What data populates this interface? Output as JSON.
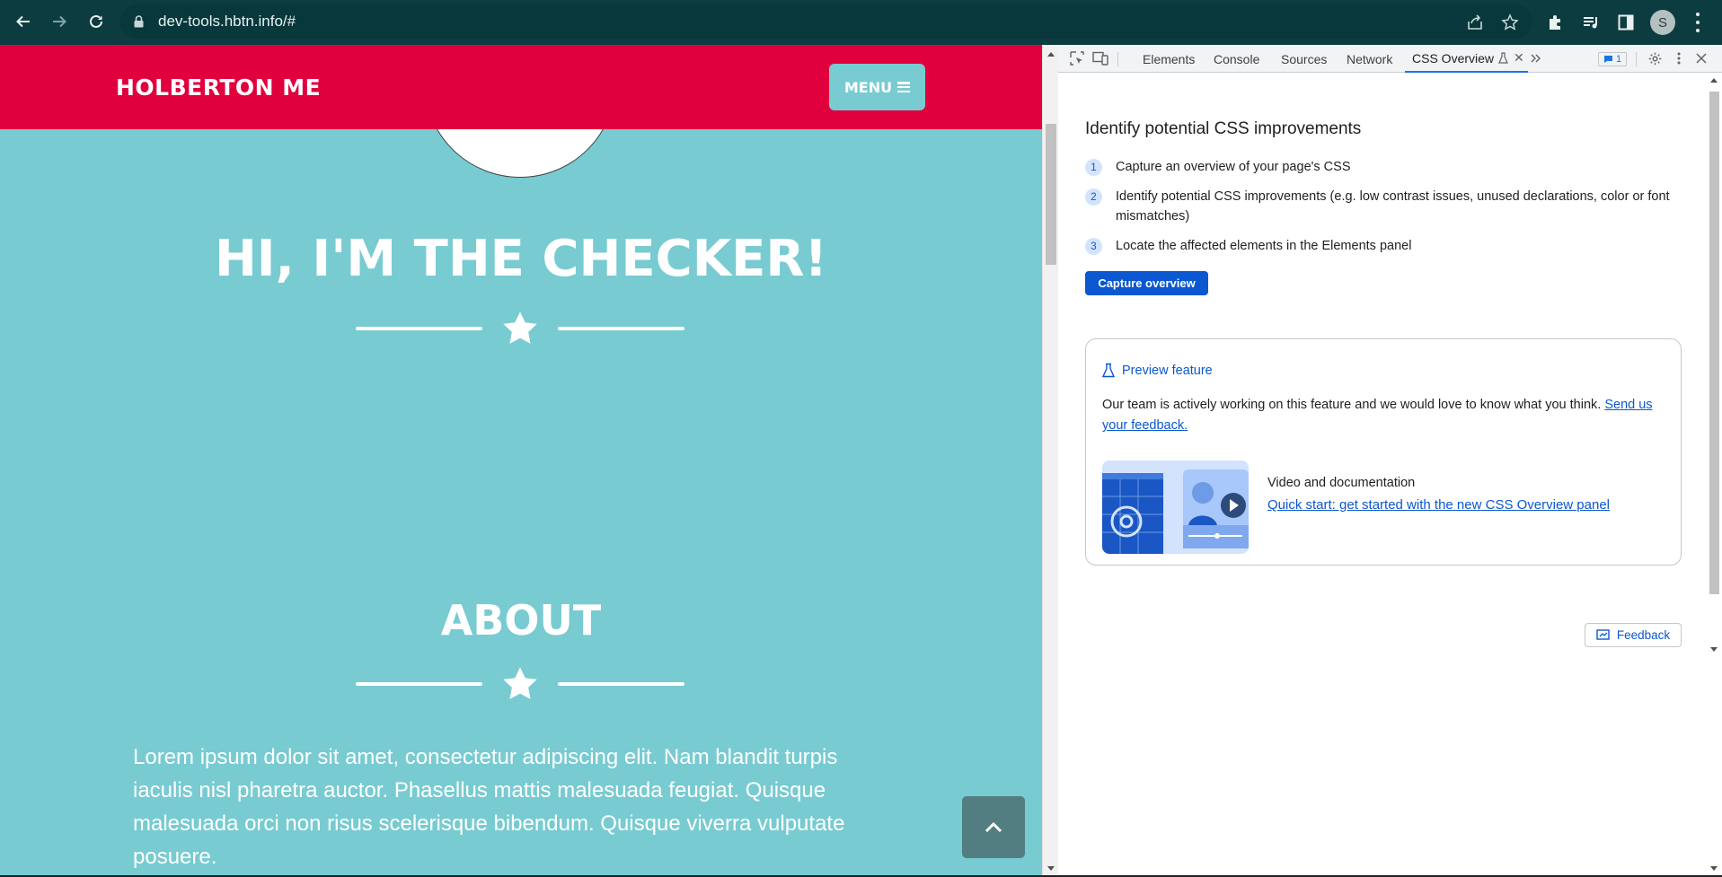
{
  "browser": {
    "url": "dev-tools.hbtn.info/#",
    "avatar_letter": "S",
    "theme_color": "#0d3c40"
  },
  "site": {
    "brand": "HOLBERTON ME",
    "menu_label": "MENU",
    "hero_title": "HI, I'M THE CHECKER!",
    "about_title": "ABOUT",
    "about_text": "Lorem ipsum dolor sit amet, consectetur adipiscing elit. Nam blandit turpis iaculis nisl pharetra auctor. Phasellus mattis malesuada feugiat. Quisque malesuada orci non risus scelerisque bibendum. Quisque viverra vulputate posuere.",
    "colors": {
      "nav": "#e0003d",
      "background": "#78cbd1",
      "scroll_button": "#527e82"
    }
  },
  "devtools": {
    "tabs": [
      {
        "label": "Elements"
      },
      {
        "label": "Console"
      },
      {
        "label": "Sources"
      },
      {
        "label": "Network"
      },
      {
        "label": "CSS Overview",
        "active": true
      }
    ],
    "issues_count": "1",
    "overview_title": "Identify potential CSS improvements",
    "steps": [
      {
        "num": "1",
        "text": "Capture an overview of your page's CSS"
      },
      {
        "num": "2",
        "text": "Identify potential CSS improvements (e.g. low contrast issues, unused declarations, color or font mismatches)"
      },
      {
        "num": "3",
        "text": "Locate the affected elements in the Elements panel"
      }
    ],
    "capture_button": "Capture overview",
    "preview": {
      "heading": "Preview feature",
      "text": "Our team is actively working on this feature and we would love to know what you think.",
      "link": "Send us your feedback.",
      "video_label": "Video and documentation",
      "video_link": "Quick start: get started with the new CSS Overview panel"
    },
    "feedback_button": "Feedback",
    "accent": "#0b57d0"
  }
}
